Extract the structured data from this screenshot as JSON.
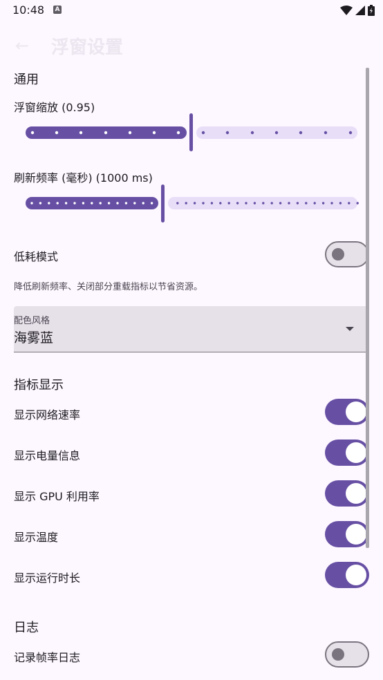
{
  "status": {
    "time": "10:48",
    "notification_icon": "a-notification-icon"
  },
  "app_bar": {
    "title": "浮窗设置",
    "back_icon": "arrow-back-icon"
  },
  "general": {
    "title": "通用",
    "scale": {
      "label": "浮窗缩放 (0.95)",
      "value_fraction": 0.5
    },
    "refresh": {
      "label": "刷新频率 (毫秒) (1000 ms)",
      "value_fraction": 0.42
    },
    "low_power": {
      "label": "低耗模式",
      "on": false,
      "description": "降低刷新频率、关闭部分重载指标以节省资源。"
    },
    "color_style": {
      "label": "配色风格",
      "value": "海雾蓝"
    }
  },
  "metrics": {
    "title": "指标显示",
    "items": [
      {
        "label": "显示网络速率",
        "on": true
      },
      {
        "label": "显示电量信息",
        "on": true
      },
      {
        "label": "显示 GPU 利用率",
        "on": true
      },
      {
        "label": "显示温度",
        "on": true
      },
      {
        "label": "显示运行时长",
        "on": true
      }
    ]
  },
  "logs": {
    "title": "日志",
    "items": [
      {
        "label": "记录帧率日志",
        "on": false
      }
    ]
  },
  "colors": {
    "accent": "#6750a4",
    "track_inactive": "#e8def8",
    "background": "#fdf7ff"
  }
}
